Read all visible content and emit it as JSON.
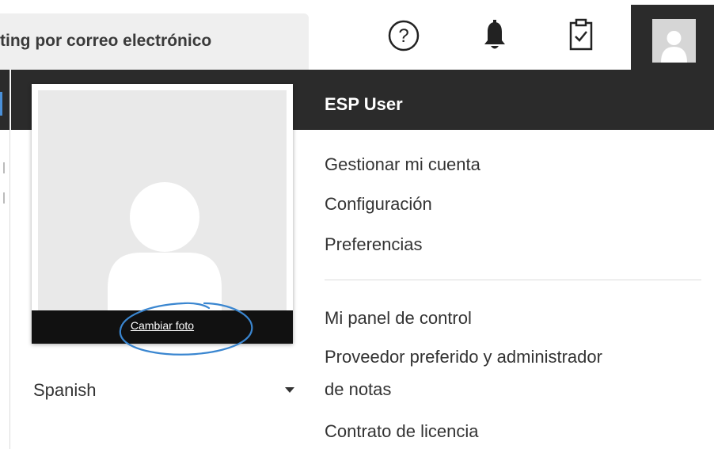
{
  "header": {
    "search_tab_text": "ting por correo electrónico",
    "icons": [
      "help-icon",
      "bell-icon",
      "clipboard-check-icon",
      "avatar"
    ]
  },
  "user": {
    "name": "ESP User"
  },
  "profile": {
    "change_photo_label": "Cambiar foto",
    "language_value": "Spanish"
  },
  "menu": {
    "group1": [
      "Gestionar mi cuenta",
      "Configuración",
      "Preferencias"
    ],
    "group2": [
      "Mi panel de control",
      "Proveedor preferido y administrador",
      "de notas",
      "Contrato de licencia"
    ]
  },
  "colors": {
    "header_dark": "#2b2b2b",
    "annotation_circle": "#3a86d0",
    "caption_bar": "#111111"
  }
}
